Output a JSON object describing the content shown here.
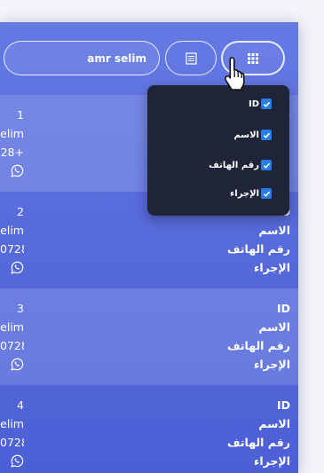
{
  "toolbar": {
    "search_value": "amr selim",
    "list_icon": "list-icon",
    "grid_icon": "grid-icon"
  },
  "labels": {
    "id": "ID",
    "name": "الاسم",
    "phone": "رقم الهاتف",
    "action": "الإجراء"
  },
  "rows": [
    {
      "id": "1",
      "name": "elim",
      "phone": "28+"
    },
    {
      "id": "2",
      "name": "elim",
      "phone": "0728"
    },
    {
      "id": "3",
      "name": "elim",
      "phone": "0728"
    },
    {
      "id": "4",
      "name": "elim",
      "phone": "0728"
    }
  ],
  "column_menu": {
    "items": [
      {
        "label": "ID",
        "checked": true
      },
      {
        "label": "الاسم",
        "checked": true
      },
      {
        "label": "رقم الهاتف",
        "checked": true
      },
      {
        "label": "الإجراء",
        "checked": true
      }
    ]
  },
  "colors": {
    "panel_top": "#6479e3",
    "panel_bottom": "#4f63d9",
    "dropdown_bg": "#1f2438",
    "checkbox": "#2a7be4"
  }
}
